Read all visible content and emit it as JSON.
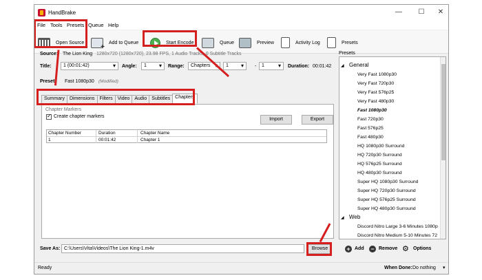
{
  "window": {
    "title": "HandBrake",
    "controls": [
      "—",
      "☐",
      "✕"
    ]
  },
  "menu": [
    "File",
    "Tools",
    "Presets",
    "Queue",
    "Help"
  ],
  "toolbar": {
    "open_source": "Open Source",
    "add_to_queue": "Add to Queue",
    "start_encode": "Start Encode",
    "queue": "Queue",
    "preview": "Preview",
    "activity_log": "Activity Log",
    "presets": "Presets"
  },
  "source": {
    "label": "Source:",
    "name": "The Lion King",
    "info": "1280x720 (1280x720), 23.98 FPS, 1 Audio Tracks, 0 Subtitle Tracks"
  },
  "title_row": {
    "title_label": "Title:",
    "title_value": "1 (00:01:42)",
    "angle_label": "Angle:",
    "angle_value": "1",
    "range_label": "Range:",
    "range_value": "Chapters",
    "range_from": "1",
    "dash": "-",
    "range_to": "1",
    "duration_label": "Duration:",
    "duration_value": "00:01:42"
  },
  "preset": {
    "label": "Preset:",
    "value": "Fast 1080p30",
    "modified": "(Modified)"
  },
  "tabs": [
    "Summary",
    "Dimensions",
    "Filters",
    "Video",
    "Audio",
    "Subtitles",
    "Chapters"
  ],
  "chapters": {
    "section_title": "Chapter Markers",
    "create_markers_label": "Create chapter markers",
    "import_label": "Import",
    "export_label": "Export",
    "columns": [
      "Chapter Number",
      "Duration",
      "Chapter Name"
    ],
    "rows": [
      {
        "number": "1",
        "duration": "00:01:42",
        "name": "Chapter 1"
      }
    ]
  },
  "save_as": {
    "label": "Save As:",
    "value": "C:\\Users\\Vita\\Videos\\The Lion King-1.m4v",
    "browse_label": "Browse"
  },
  "status": {
    "text": "Ready",
    "when_done_label": "When Done:",
    "when_done_value": "Do nothing"
  },
  "presets_panel": {
    "title": "Presets",
    "groups": [
      {
        "name": "General",
        "items": [
          "Very Fast 1080p30",
          "Very Fast 720p30",
          "Very Fast 576p25",
          "Very Fast 480p30",
          "Fast 1080p30",
          "Fast 720p30",
          "Fast 576p25",
          "Fast 480p30",
          "HQ 1080p30 Surround",
          "HQ 720p30 Surround",
          "HQ 576p25 Surround",
          "HQ 480p30 Surround",
          "Super HQ 1080p30 Surround",
          "Super HQ 720p30 Surround",
          "Super HQ 576p25 Surround",
          "Super HQ 480p30 Surround"
        ]
      },
      {
        "name": "Web",
        "items": [
          "Discord Nitro Large 3-6 Minutes 1080p",
          "Discord Nitro Medium 5-10 Minutes 72"
        ]
      }
    ],
    "add_label": "Add",
    "remove_label": "Remove",
    "options_label": "Options"
  },
  "colors": {
    "highlight": "#d51e1e",
    "window_bg": "#f0f0f0",
    "start_green": "#4caf50"
  }
}
